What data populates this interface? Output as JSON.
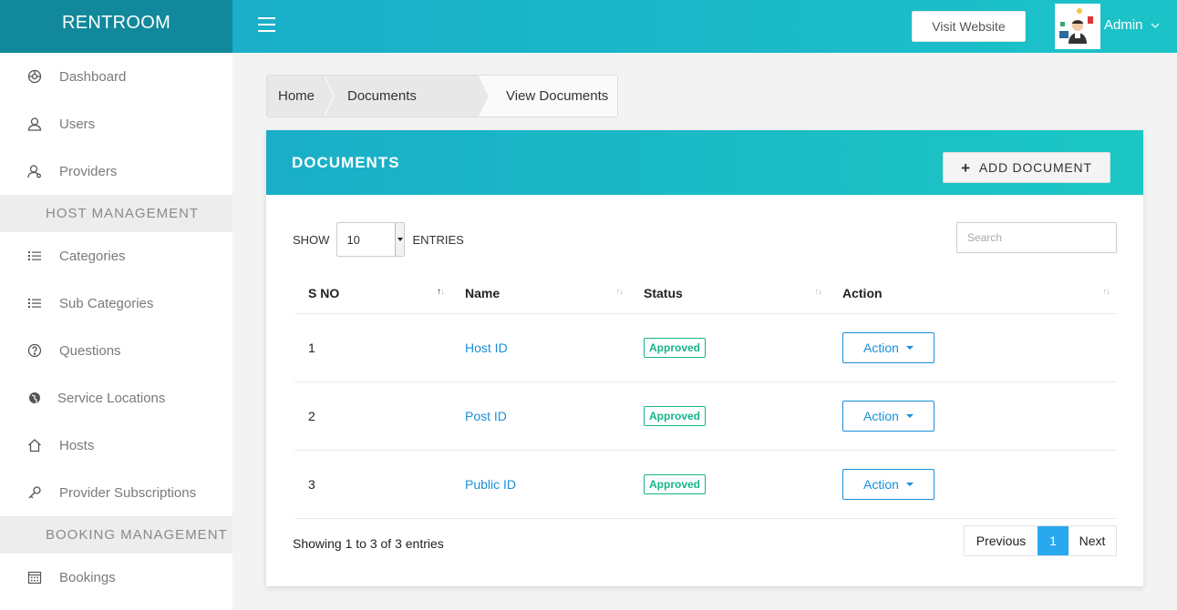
{
  "brand": "RENTROOM",
  "topbar": {
    "visit_label": "Visit Website",
    "user_name": "Admin"
  },
  "sidebar": {
    "items_top": [
      {
        "label": "Dashboard",
        "icon": "dashboard-icon"
      },
      {
        "label": "Users",
        "icon": "user-icon"
      },
      {
        "label": "Providers",
        "icon": "provider-icon"
      }
    ],
    "section_host": "HOST MANAGEMENT",
    "items_host": [
      {
        "label": "Categories",
        "icon": "list-icon"
      },
      {
        "label": "Sub Categories",
        "icon": "list-icon"
      },
      {
        "label": "Questions",
        "icon": "question-icon"
      },
      {
        "label": "Service Locations",
        "icon": "globe-icon"
      },
      {
        "label": "Hosts",
        "icon": "home-icon"
      },
      {
        "label": "Provider Subscriptions",
        "icon": "key-icon"
      }
    ],
    "section_booking": "BOOKING MANAGEMENT",
    "items_booking": [
      {
        "label": "Bookings",
        "icon": "calendar-icon"
      }
    ]
  },
  "breadcrumb": {
    "home": "Home",
    "documents": "Documents",
    "current": "View Documents"
  },
  "card": {
    "title": "DOCUMENTS",
    "add_label": "ADD DOCUMENT"
  },
  "table_controls": {
    "show_label": "SHOW",
    "entries_value": "10",
    "entries_label": "ENTRIES",
    "search_placeholder": "Search"
  },
  "table": {
    "columns": [
      "S NO",
      "Name",
      "Status",
      "Action"
    ],
    "rows": [
      {
        "sno": "1",
        "name": "Host ID",
        "status": "Approved",
        "action": "Action"
      },
      {
        "sno": "2",
        "name": "Post ID",
        "status": "Approved",
        "action": "Action"
      },
      {
        "sno": "3",
        "name": "Public ID",
        "status": "Approved",
        "action": "Action"
      }
    ]
  },
  "footer": {
    "info": "Showing 1 to 3 of 3 entries",
    "prev": "Previous",
    "page": "1",
    "next": "Next"
  },
  "colors": {
    "brand_dark": "#11889b",
    "header_gradient_start": "#1aaec8",
    "header_gradient_end": "#1bc3c8",
    "link": "#1a8fd8",
    "approved": "#17b48a",
    "active_page": "#2aa8ee"
  }
}
